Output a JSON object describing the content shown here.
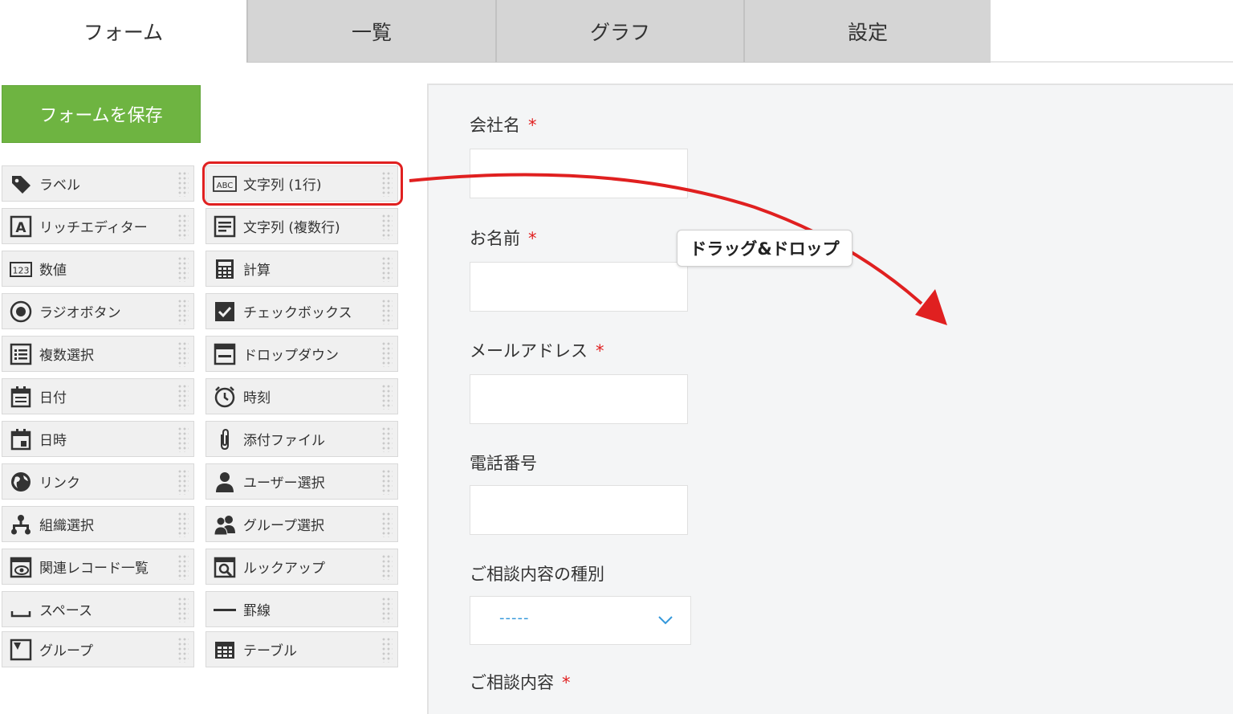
{
  "tabs": [
    {
      "label": "フォーム",
      "active": true
    },
    {
      "label": "一覧",
      "active": false
    },
    {
      "label": "グラフ",
      "active": false
    },
    {
      "label": "設定",
      "active": false
    }
  ],
  "save_button": "フォームを保存",
  "palette": {
    "left": [
      {
        "label": "ラベル",
        "icon": "tag-icon"
      },
      {
        "label": "リッチエディター",
        "icon": "rich-editor-icon"
      },
      {
        "label": "数値",
        "icon": "number-icon"
      },
      {
        "label": "ラジオボタン",
        "icon": "radio-icon"
      },
      {
        "label": "複数選択",
        "icon": "multi-select-icon"
      },
      {
        "label": "日付",
        "icon": "calendar-icon"
      },
      {
        "label": "日時",
        "icon": "calendar-time-icon"
      },
      {
        "label": "リンク",
        "icon": "globe-icon"
      },
      {
        "label": "組織選択",
        "icon": "org-icon"
      },
      {
        "label": "関連レコード一覧",
        "icon": "related-records-icon"
      },
      {
        "label": "スペース",
        "icon": "space-icon"
      },
      {
        "label": "グループ",
        "icon": "group-field-icon"
      }
    ],
    "right": [
      {
        "label": "文字列 (1行)",
        "icon": "abc-icon"
      },
      {
        "label": "文字列 (複数行)",
        "icon": "multiline-text-icon"
      },
      {
        "label": "計算",
        "icon": "calculator-icon"
      },
      {
        "label": "チェックボックス",
        "icon": "checkbox-icon"
      },
      {
        "label": "ドロップダウン",
        "icon": "dropdown-icon"
      },
      {
        "label": "時刻",
        "icon": "clock-icon"
      },
      {
        "label": "添付ファイル",
        "icon": "paperclip-icon"
      },
      {
        "label": "ユーザー選択",
        "icon": "user-icon"
      },
      {
        "label": "グループ選択",
        "icon": "users-icon"
      },
      {
        "label": "ルックアップ",
        "icon": "lookup-icon"
      },
      {
        "label": "罫線",
        "icon": "rule-line-icon"
      },
      {
        "label": "テーブル",
        "icon": "table-icon"
      }
    ]
  },
  "form_fields": [
    {
      "label": "会社名",
      "required": "*"
    },
    {
      "label": "お名前",
      "required": "*"
    },
    {
      "label": "メールアドレス",
      "required": "*"
    },
    {
      "label": "電話番号",
      "required": ""
    },
    {
      "label": "ご相談内容の種別",
      "required": "",
      "value": "-----"
    },
    {
      "label": "ご相談内容",
      "required": "*"
    }
  ],
  "annotation": "ドラッグ&ドロップ",
  "colors": {
    "accent_green": "#6eb441",
    "highlight_red": "#e02020",
    "select_blue": "#3498db"
  }
}
